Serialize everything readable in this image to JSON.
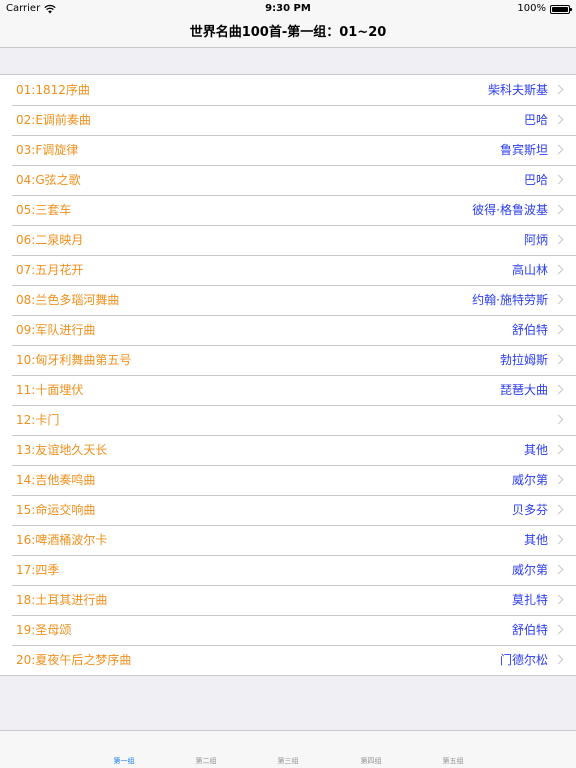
{
  "status_bar": {
    "carrier": "Carrier",
    "time": "9:30 PM",
    "battery": "100%"
  },
  "nav": {
    "title": "世界名曲100首-第一组：01~20"
  },
  "items": [
    {
      "title": "01:1812序曲",
      "detail": "柴科夫斯基"
    },
    {
      "title": "02:E调前奏曲",
      "detail": "巴哈"
    },
    {
      "title": "03:F调旋律",
      "detail": "鲁宾斯坦"
    },
    {
      "title": "04:G弦之歌",
      "detail": "巴哈"
    },
    {
      "title": "05:三套车",
      "detail": "彼得·格鲁波基"
    },
    {
      "title": "06:二泉映月",
      "detail": "阿炳"
    },
    {
      "title": "07:五月花开",
      "detail": "高山林"
    },
    {
      "title": "08:兰色多瑙河舞曲",
      "detail": "约翰·施特劳斯"
    },
    {
      "title": "09:军队进行曲",
      "detail": "舒伯特"
    },
    {
      "title": "10:匈牙利舞曲第五号",
      "detail": "勃拉姆斯"
    },
    {
      "title": "11:十面埋伏",
      "detail": "琵琶大曲"
    },
    {
      "title": "12:卡门",
      "detail": ""
    },
    {
      "title": "13:友谊地久天长",
      "detail": "其他"
    },
    {
      "title": "14:吉他奏鸣曲",
      "detail": "威尔第"
    },
    {
      "title": "15:命运交响曲",
      "detail": "贝多芬"
    },
    {
      "title": "16:啤酒桶波尔卡",
      "detail": "其他"
    },
    {
      "title": "17:四季",
      "detail": "威尔第"
    },
    {
      "title": "18:土耳其进行曲",
      "detail": "莫扎特"
    },
    {
      "title": "19:圣母颂",
      "detail": "舒伯特"
    },
    {
      "title": "20:夏夜午后之梦序曲",
      "detail": "门德尔松"
    }
  ],
  "tabs": [
    {
      "label": "第一组",
      "active": true
    },
    {
      "label": "第二组",
      "active": false
    },
    {
      "label": "第三组",
      "active": false
    },
    {
      "label": "第四组",
      "active": false
    },
    {
      "label": "第五组",
      "active": false
    }
  ],
  "colors": {
    "title_text": "#f0901c",
    "detail_text": "#2c3df2",
    "tab_active": "#1a7cf0"
  },
  "icons": {
    "accessory": "chevron-right-icon",
    "signal": "wifi-icon",
    "power": "battery-icon"
  }
}
